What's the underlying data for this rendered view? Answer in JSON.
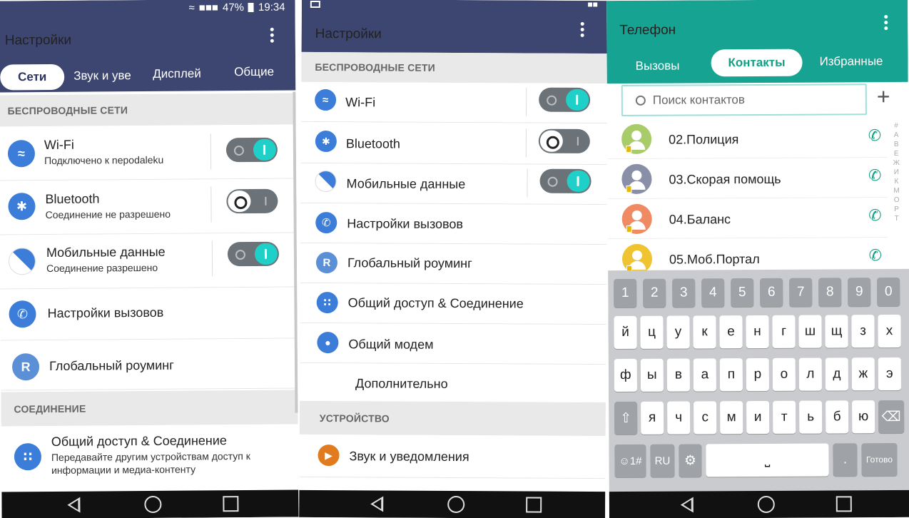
{
  "screens": [
    {
      "status": {
        "signal": "■■■",
        "battery_text": "47%",
        "time": "19:34"
      },
      "appbar": {
        "title": "Настройки",
        "menu_icon": "kebab-menu-icon",
        "color": "#3d4670"
      },
      "tabs": [
        "Сети",
        "Звук и уве",
        "Дисплей",
        "Общие"
      ],
      "active_tab": "Сети",
      "sections": [
        {
          "title": "БЕСПРОВОДНЫЕ СЕТИ",
          "items": [
            {
              "icon": "wifi-icon",
              "label": "Wi-Fi",
              "subtitle": "Подключено к nepodaleku",
              "toggle": "on"
            },
            {
              "icon": "bluetooth-icon",
              "label": "Bluetooth",
              "subtitle": "Соединение не разрешено",
              "toggle": "off"
            },
            {
              "icon": "mobile-data-icon",
              "label": "Мобильные данные",
              "subtitle": "Соединение разрешено",
              "toggle": "on"
            },
            {
              "icon": "call-settings-icon",
              "label": "Настройки вызовов"
            },
            {
              "icon": "roaming-icon",
              "label": "Глобальный роуминг"
            }
          ]
        },
        {
          "title": "СОЕДИНЕНИЕ",
          "items": [
            {
              "icon": "share-connect-icon",
              "label": "Общий доступ & Соединение",
              "subtitle": "Передавайте другим устройствам доступ к",
              "subtitle2": "информации и медиа-контенту"
            }
          ]
        }
      ]
    },
    {
      "appbar": {
        "title": "Настройки",
        "menu_icon": "kebab-menu-icon",
        "color": "#3d4670"
      },
      "sections": [
        {
          "title": "БЕСПРОВОДНЫЕ СЕТИ",
          "items": [
            {
              "icon": "wifi-icon",
              "label": "Wi-Fi",
              "toggle": "on"
            },
            {
              "icon": "bluetooth-icon",
              "label": "Bluetooth",
              "toggle": "off"
            },
            {
              "icon": "mobile-data-icon",
              "label": "Мобильные данные",
              "toggle": "on"
            },
            {
              "icon": "call-settings-icon",
              "label": "Настройки вызовов"
            },
            {
              "icon": "roaming-icon",
              "label": "Глобальный роуминг"
            },
            {
              "icon": "share-connect-icon",
              "label": "Общий доступ & Соединение"
            },
            {
              "icon": "modem-icon",
              "label": "Общий модем"
            },
            {
              "label": "Дополнительно"
            }
          ]
        },
        {
          "title": "УСТРОЙСТВО",
          "items": [
            {
              "icon": "sound-icon",
              "label": "Звук и уведомления"
            }
          ]
        }
      ]
    },
    {
      "appbar": {
        "title": "Телефон",
        "menu_icon": "kebab-menu-icon",
        "color": "#17a392"
      },
      "tabs": [
        "Вызовы",
        "Контакты",
        "Избранные"
      ],
      "active_tab": "Контакты",
      "search_placeholder": "Поиск контактов",
      "contacts": [
        {
          "name": "02.Полиция",
          "avatar_color": "#a8cc6a"
        },
        {
          "name": "03.Скорая помощь",
          "avatar_color": "#8a8fa8"
        },
        {
          "name": "04.Баланс",
          "avatar_color": "#ef8a62"
        },
        {
          "name": "05.Моб.Портал",
          "avatar_color": "#f0c430"
        }
      ],
      "index_letters": [
        "#",
        "А",
        "В",
        "Е",
        "Ж",
        "И",
        "К",
        "М",
        "О",
        "Р",
        "Т"
      ],
      "keyboard": {
        "numbers": [
          "1",
          "2",
          "3",
          "4",
          "5",
          "6",
          "7",
          "8",
          "9",
          "0"
        ],
        "row1": [
          "й",
          "ц",
          "у",
          "к",
          "е",
          "н",
          "г",
          "ш",
          "щ",
          "з",
          "х"
        ],
        "row2": [
          "ф",
          "ы",
          "в",
          "а",
          "п",
          "р",
          "о",
          "л",
          "д",
          "ж",
          "э"
        ],
        "row3": [
          "я",
          "ч",
          "с",
          "м",
          "и",
          "т",
          "ь",
          "б",
          "ю"
        ],
        "symbols_key": "☺1#",
        "lang_key": "RU",
        "done_key": "Готово",
        "dot_key": "."
      }
    }
  ]
}
